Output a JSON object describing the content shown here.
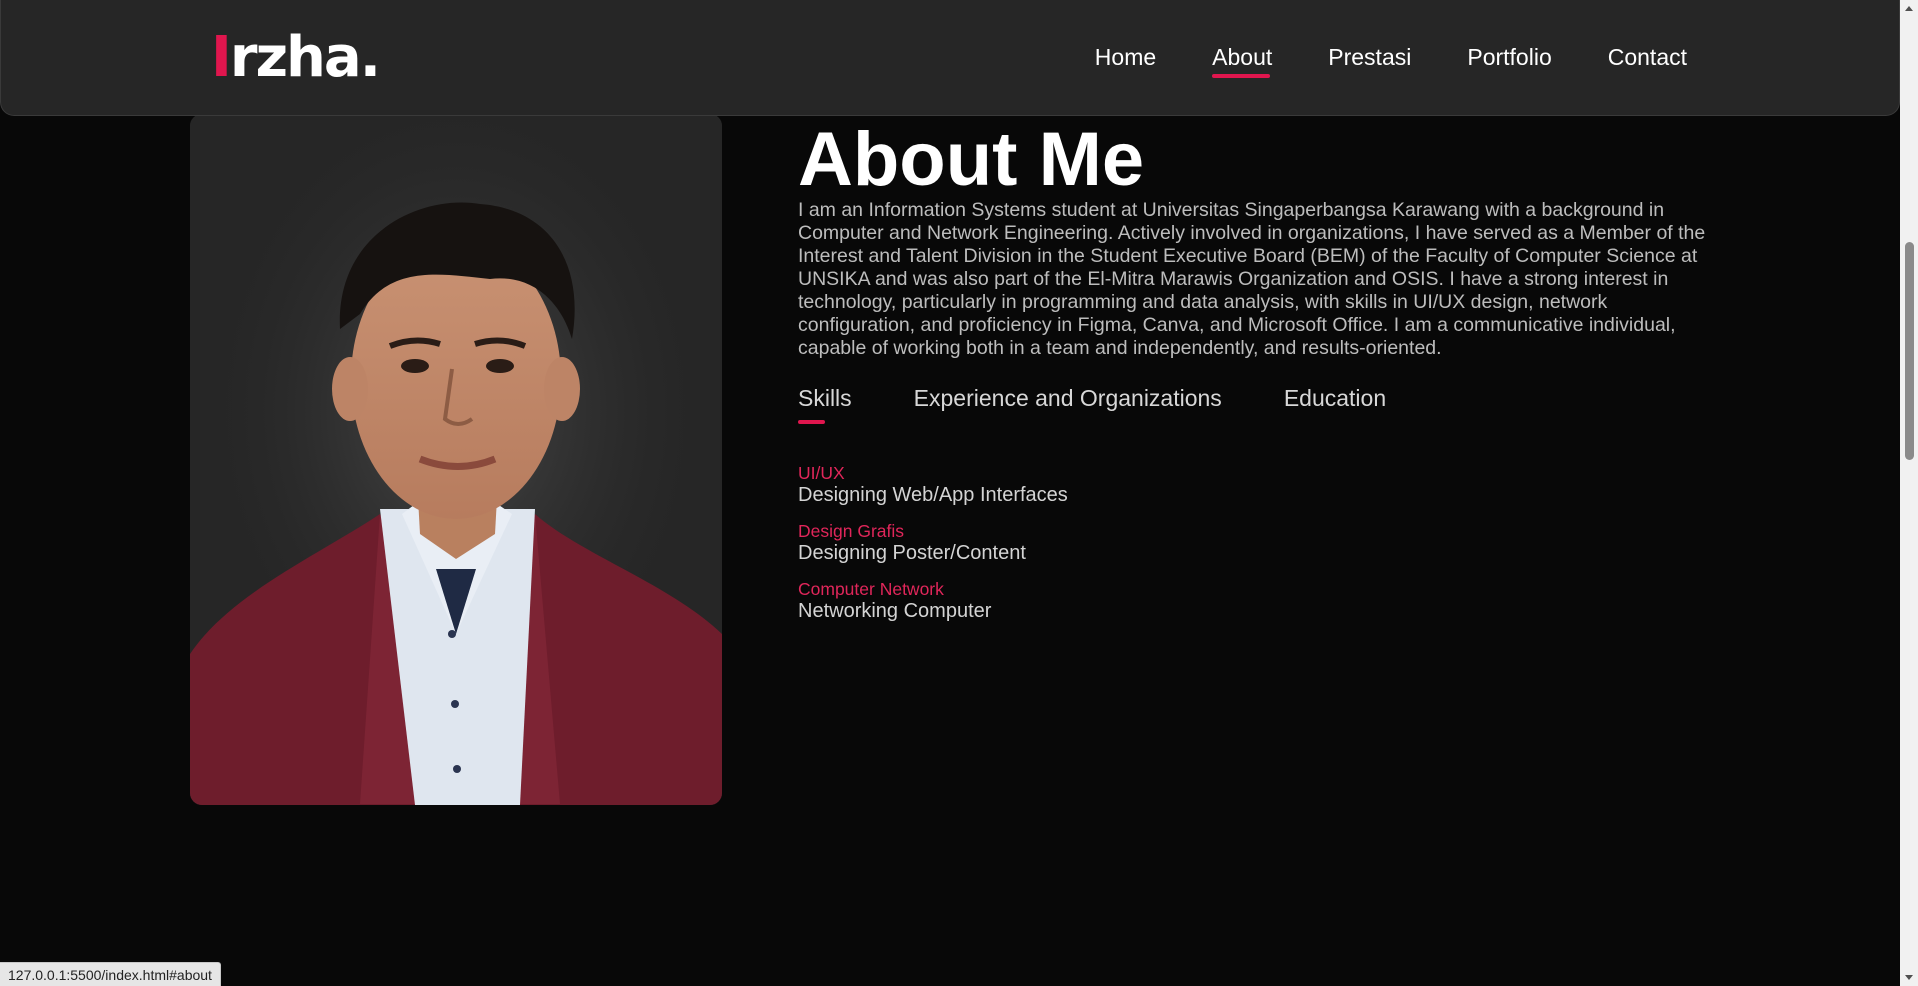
{
  "logo": {
    "first_letter": "I",
    "rest": "rzha."
  },
  "nav": {
    "items": [
      {
        "label": "Home"
      },
      {
        "label": "About"
      },
      {
        "label": "Prestasi"
      },
      {
        "label": "Portfolio"
      },
      {
        "label": "Contact"
      }
    ],
    "active": "About"
  },
  "about": {
    "title": "About Me",
    "description": "I am an Information Systems student at Universitas Singaperbangsa Karawang with a background in Computer and Network Engineering. Actively involved in organizations, I have served as a Member of the Interest and Talent Division in the Student Executive Board (BEM) of the Faculty of Computer Science at UNSIKA and was also part of the El-Mitra Marawis Organization and OSIS. I have a strong interest in technology, particularly in programming and data analysis, with skills in UI/UX design, network configuration, and proficiency in Figma, Canva, and Microsoft Office. I am a communicative individual, capable of working both in a team and independently, and results-oriented."
  },
  "tabs": [
    {
      "label": "Skills"
    },
    {
      "label": "Experience and Organizations"
    },
    {
      "label": "Education"
    }
  ],
  "skills": [
    {
      "name": "UI/UX",
      "desc": "Designing Web/App Interfaces"
    },
    {
      "name": "Design Grafis",
      "desc": "Designing Poster/Content"
    },
    {
      "name": "Computer Network",
      "desc": "Networking Computer"
    }
  ],
  "status_bar": {
    "url": "127.0.0.1:5500/index.html#about"
  },
  "colors": {
    "accent": "#e0164e",
    "background": "#080808",
    "navbar": "#262626"
  }
}
